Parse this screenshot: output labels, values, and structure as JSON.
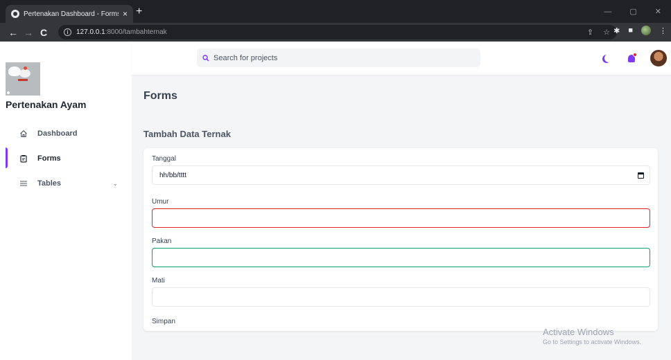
{
  "browser": {
    "tab_title": "Pertenakan Dashboard - Forms",
    "tab_close": "×",
    "new_tab": "+",
    "url_host": "127.0.0.1",
    "url_rest": ":8000/tambahternak",
    "nav_back": "←",
    "nav_forward": "→",
    "nav_reload": "C",
    "share_glyph": "⇪",
    "bookmark_glyph": "☆",
    "ext_glyph": "✱",
    "sidepanel_glyph": "■",
    "menu_glyph": "⋮",
    "minimize": "—",
    "restore": "▢",
    "close": "✕"
  },
  "sidebar": {
    "brand": "Pertenakan Ayam",
    "items": [
      {
        "label": "Dashboard",
        "icon": "home-icon",
        "active": false
      },
      {
        "label": "Forms",
        "icon": "clipboard-icon",
        "active": true
      },
      {
        "label": "Tables",
        "icon": "table-icon",
        "active": false,
        "chevron": "⌄"
      }
    ]
  },
  "topbar": {
    "search_placeholder": "Search for projects",
    "icons": [
      "moon-icon",
      "bell-icon",
      "avatar"
    ]
  },
  "main": {
    "page_title": "Forms",
    "section_title": "Tambah Data Ternak",
    "fields": [
      {
        "label": "Tanggal",
        "value": "hh/bb/tttt",
        "state": "default"
      },
      {
        "label": "Umur",
        "value": "",
        "state": "error"
      },
      {
        "label": "Pakan",
        "value": "",
        "state": "success"
      },
      {
        "label": "Mati",
        "value": "",
        "state": "default"
      }
    ],
    "submit_label": "Simpan"
  },
  "watermark": {
    "title": "Activate Windows",
    "subtitle": "Go to Settings to activate Windows."
  },
  "colors": {
    "accent": "#7e3af2",
    "error": "#e02424",
    "success": "#0e9f6e",
    "chrome_dark": "#202124"
  }
}
